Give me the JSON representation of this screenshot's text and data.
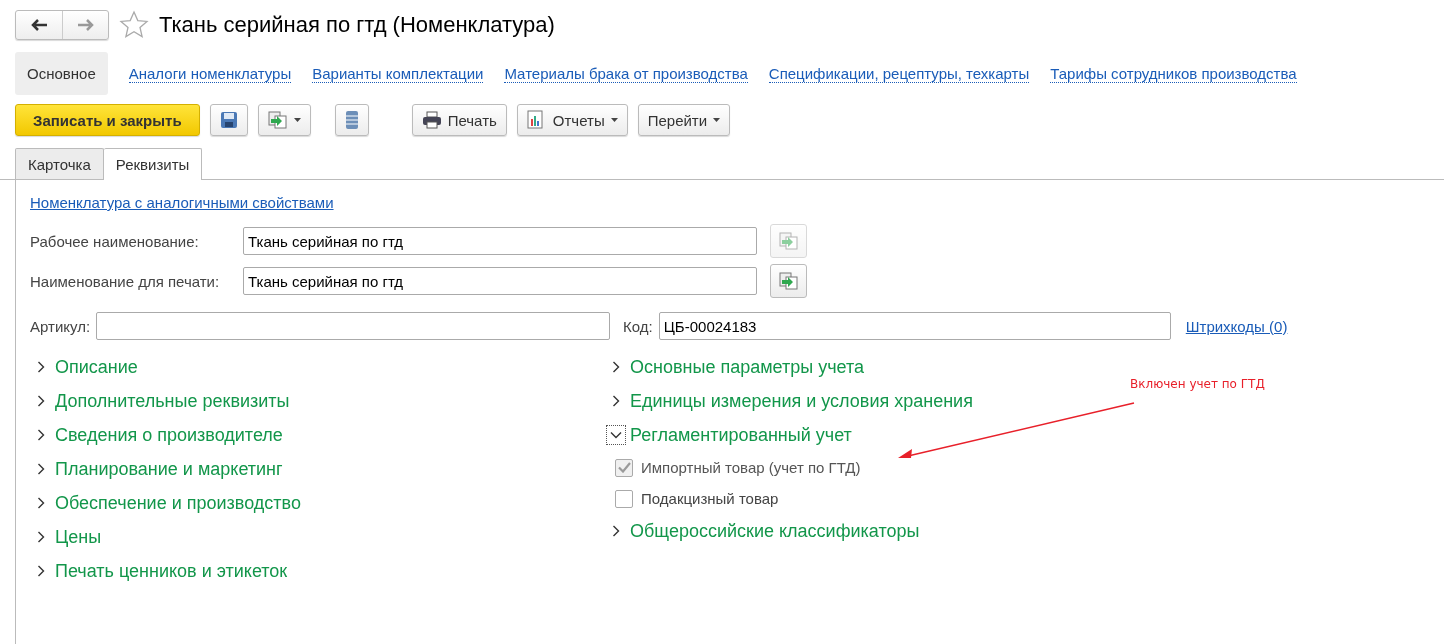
{
  "window": {
    "title": "Ткань серийная по гтд (Номенклатура)",
    "favorite": false
  },
  "nav_links": [
    {
      "label": "Основное",
      "selected": true
    },
    {
      "label": "Аналоги номенклатуры",
      "selected": false
    },
    {
      "label": "Варианты комплектации",
      "selected": false
    },
    {
      "label": "Материалы брака от производства",
      "selected": false
    },
    {
      "label": "Спецификации, рецептуры, техкарты",
      "selected": false
    },
    {
      "label": "Тарифы сотрудников производства",
      "selected": false
    }
  ],
  "toolbar": [
    {
      "kind": "primary",
      "label": "Записать и закрыть"
    },
    {
      "kind": "save"
    },
    {
      "kind": "copymenu"
    },
    {
      "kind": "list"
    },
    {
      "kind": "print",
      "label": "Печать"
    },
    {
      "kind": "reports",
      "label": "Отчеты"
    },
    {
      "kind": "goto",
      "label": "Перейти"
    }
  ],
  "tabs": [
    {
      "label": "Карточка",
      "selected": false
    },
    {
      "label": "Реквизиты",
      "selected": true
    }
  ],
  "similar_link": "Номенклатура с аналогичными свойствами",
  "name_fields": [
    {
      "label": "Рабочее наименование:",
      "value": "Ткань серийная по гтд",
      "disabled": true
    },
    {
      "label": "Наименование для печати:",
      "value": "Ткань серийная по гтд",
      "disabled": false
    }
  ],
  "article": {
    "label": "Артикул:"
  },
  "code": {
    "label": "Код:",
    "value": "ЦБ-00024183"
  },
  "barcodes_link": "Штрихкоды (0)",
  "left_groups": [
    {
      "label": "Описание",
      "expanded": false
    },
    {
      "label": "Дополнительные реквизиты",
      "expanded": false
    },
    {
      "label": "Сведения о производителе",
      "expanded": false
    },
    {
      "label": "Планирование и маркетинг",
      "expanded": false
    },
    {
      "label": "Обеспечение и производство",
      "expanded": false
    },
    {
      "label": "Цены",
      "expanded": false
    },
    {
      "label": "Печать ценников и этикеток",
      "expanded": false
    }
  ],
  "right_groups": [
    {
      "label": "Основные параметры учета",
      "expanded": false
    },
    {
      "label": "Единицы измерения и условия хранения",
      "expanded": false
    },
    {
      "label": "Регламентированный учет",
      "expanded": true,
      "children": [
        {
          "label": "Импортный товар (учет по ГТД)",
          "checked": true,
          "disabled": true
        },
        {
          "label": "Подакцизный товар",
          "checked": false,
          "disabled": false
        }
      ]
    },
    {
      "label": "Общероссийские классификаторы",
      "expanded": false
    }
  ],
  "annotation": {
    "text": "Включен учет по ГТД"
  }
}
